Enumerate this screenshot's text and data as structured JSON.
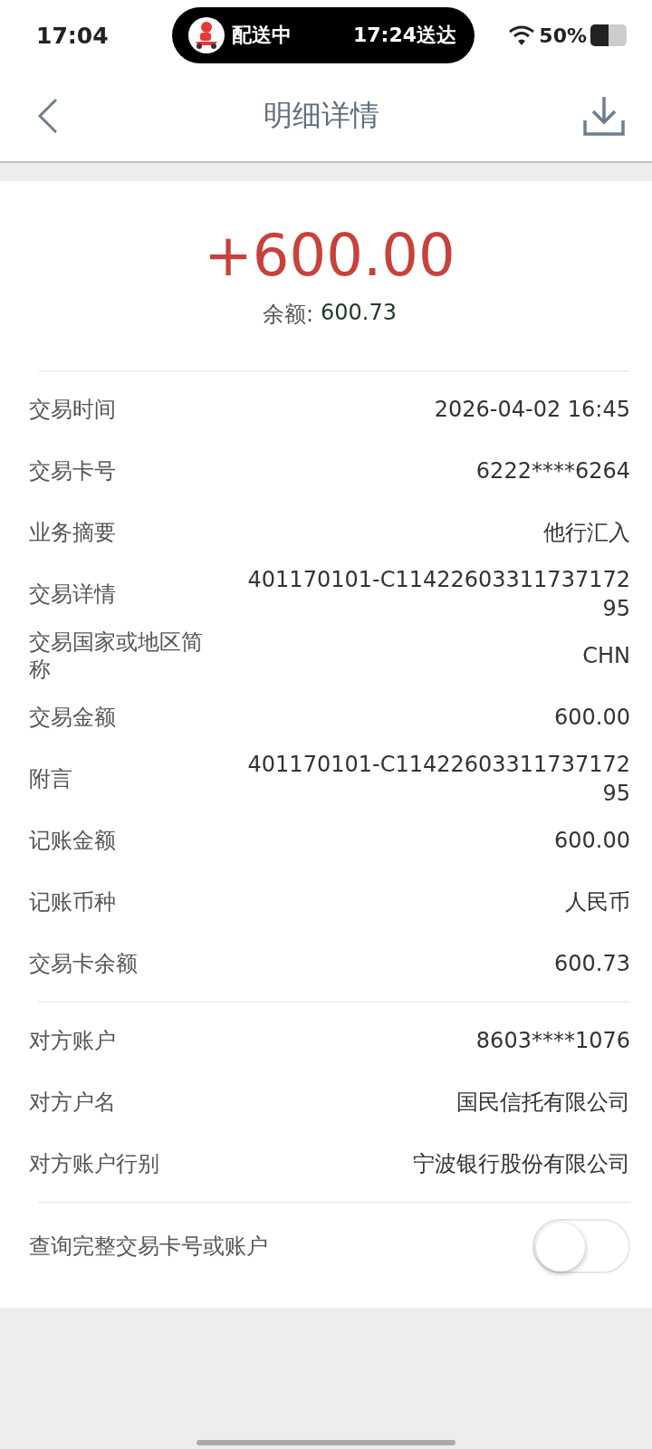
{
  "status_bar": {
    "time": "17:04",
    "activity": {
      "status": "配送中",
      "eta": "17:24送达"
    },
    "battery": "50%"
  },
  "header": {
    "title": "明细详情"
  },
  "summary": {
    "amount": "+600.00",
    "balance_label": "余额:",
    "balance": "600.73"
  },
  "sections": [
    {
      "rows": [
        {
          "label": "交易时间",
          "value": "2026-04-02 16:45"
        },
        {
          "label": "交易卡号",
          "value": "6222****6264"
        },
        {
          "label": "业务摘要",
          "value": "他行汇入"
        },
        {
          "label": "交易详情",
          "value": "401170101-C11422603311737172 95"
        },
        {
          "label": "交易国家或地区简称",
          "value": "CHN"
        },
        {
          "label": "交易金额",
          "value": "600.00"
        },
        {
          "label": "附言",
          "value": "401170101-C11422603311737172 95"
        },
        {
          "label": "记账金额",
          "value": "600.00"
        },
        {
          "label": "记账币种",
          "value": "人民币"
        },
        {
          "label": "交易卡余额",
          "value": "600.73"
        }
      ]
    },
    {
      "rows": [
        {
          "label": "对方账户",
          "value": "8603****1076"
        },
        {
          "label": "对方户名",
          "value": "国民信托有限公司"
        },
        {
          "label": "对方账户行别",
          "value": "宁波银行股份有限公司"
        }
      ]
    }
  ],
  "toggle": {
    "label": "查询完整交易卡号或账户",
    "on": false
  }
}
